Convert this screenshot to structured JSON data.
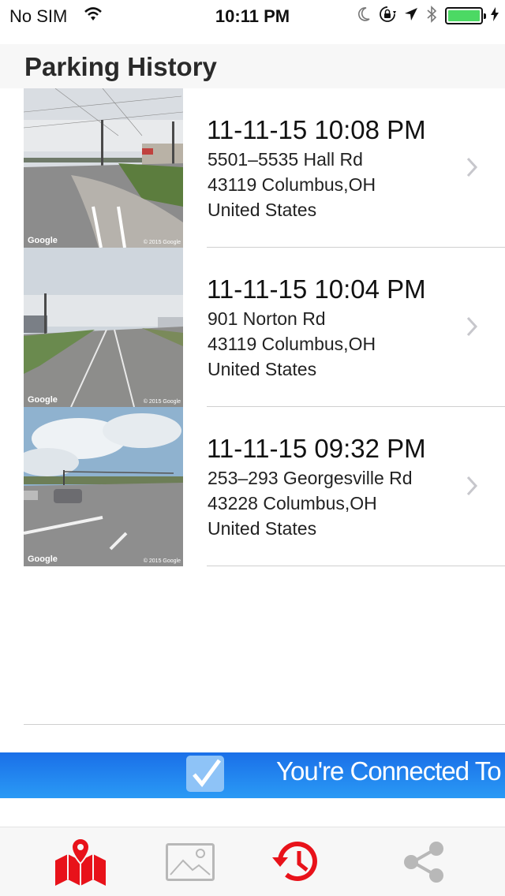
{
  "status_bar": {
    "carrier": "No SIM",
    "time": "10:11 PM",
    "icons": [
      "wifi-icon",
      "moon-icon",
      "orientation-lock-icon",
      "location-arrow-icon",
      "bluetooth-icon",
      "battery-icon",
      "charging-bolt-icon"
    ],
    "battery_color": "#4cd964"
  },
  "header": {
    "title": "Parking History"
  },
  "history": [
    {
      "datetime": "11-11-15 10:08 PM",
      "street": "5501–5535 Hall Rd",
      "city": "43119 Columbus,OH",
      "country": "United States",
      "thumb_brand": "Google",
      "thumb_copyright": "© 2015 Google"
    },
    {
      "datetime": "11-11-15 10:04 PM",
      "street": "901 Norton Rd",
      "city": "43119 Columbus,OH",
      "country": "United States",
      "thumb_brand": "Google",
      "thumb_copyright": "© 2015 Google"
    },
    {
      "datetime": "11-11-15 09:32 PM",
      "street": "253–293 Georgesville Rd",
      "city": "43228 Columbus,OH",
      "country": "United States",
      "thumb_brand": "Google",
      "thumb_copyright": "© 2015 Google"
    }
  ],
  "banner": {
    "text": "You're Connected To iA",
    "color": "#1a7fee"
  },
  "tab_bar": {
    "tabs": [
      {
        "icon": "map-pin-icon",
        "active": true
      },
      {
        "icon": "image-icon",
        "active": false
      },
      {
        "icon": "history-icon",
        "active": true
      },
      {
        "icon": "share-icon",
        "active": false
      }
    ],
    "accent_color": "#e8121a"
  }
}
